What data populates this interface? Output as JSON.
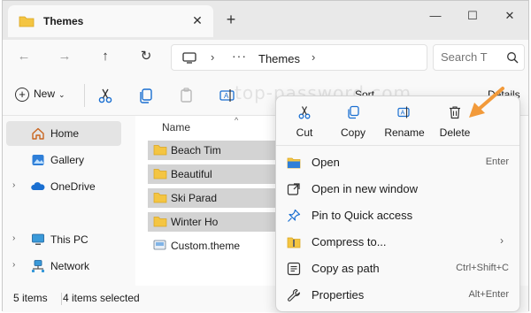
{
  "window": {
    "tab_title": "Themes",
    "tab_close": "✕",
    "new_tab": "+",
    "minimize": "—",
    "maximize": "☐",
    "close": "✕"
  },
  "navigation": {
    "back": "←",
    "forward": "→",
    "up": "↑",
    "refresh": "↻"
  },
  "address": {
    "separator": "›",
    "ellipsis": "···",
    "crumb": "Themes",
    "expand": "⌄"
  },
  "search": {
    "placeholder": "Search T"
  },
  "commandbar": {
    "new_label": "New",
    "new_chevron": "⌄",
    "sort_label": "Sort",
    "details_label": "Details",
    "watermark": "top-password.com"
  },
  "sidebar": {
    "items": [
      {
        "label": "Home",
        "icon": "home-icon",
        "selected": true,
        "chevron": ""
      },
      {
        "label": "Gallery",
        "icon": "gallery-icon",
        "selected": false,
        "chevron": ""
      },
      {
        "label": "OneDrive",
        "icon": "cloud-icon",
        "selected": false,
        "chevron": "›"
      },
      {
        "label": "This PC",
        "icon": "pc-icon",
        "selected": false,
        "chevron": "›"
      },
      {
        "label": "Network",
        "icon": "network-icon",
        "selected": false,
        "chevron": "›"
      }
    ]
  },
  "filelist": {
    "column_name": "Name",
    "sort_caret": "^",
    "files": [
      {
        "name": "Beach Tim",
        "type": "folder",
        "selected": true
      },
      {
        "name": "Beautiful",
        "type": "folder",
        "selected": true
      },
      {
        "name": "Ski Parad",
        "type": "folder",
        "selected": true
      },
      {
        "name": "Winter Ho",
        "type": "folder",
        "selected": true
      },
      {
        "name": "Custom.theme",
        "type": "theme-file",
        "selected": false
      }
    ]
  },
  "status": {
    "items_count": "5 items",
    "selected_count": "4 items selected"
  },
  "context_menu": {
    "actions": [
      {
        "label": "Cut",
        "icon": "scissors-icon"
      },
      {
        "label": "Copy",
        "icon": "copy-icon"
      },
      {
        "label": "Rename",
        "icon": "rename-icon"
      },
      {
        "label": "Delete",
        "icon": "trash-icon"
      }
    ],
    "items": [
      {
        "label": "Open",
        "shortcut": "Enter",
        "icon": "folder-open-icon"
      },
      {
        "label": "Open in new window",
        "shortcut": "",
        "icon": "new-window-icon"
      },
      {
        "label": "Pin to Quick access",
        "shortcut": "",
        "icon": "pin-icon"
      },
      {
        "label": "Compress to...",
        "shortcut": "",
        "submenu": "›",
        "icon": "archive-icon"
      },
      {
        "label": "Copy as path",
        "shortcut": "Ctrl+Shift+C",
        "icon": "path-icon"
      },
      {
        "label": "Properties",
        "shortcut": "Alt+Enter",
        "icon": "wrench-icon"
      }
    ]
  },
  "colors": {
    "folder": "#f4c542",
    "accent": "#1a6fd1",
    "arrow": "#f29a3a",
    "selection": "#d3d3d3"
  }
}
